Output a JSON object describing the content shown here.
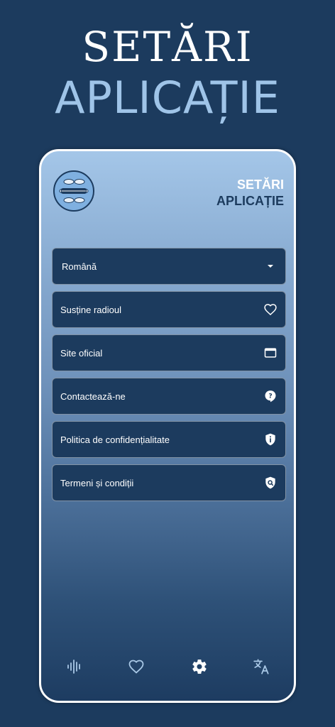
{
  "hero": {
    "line1": "SETĂRI",
    "line2": "APLICAȚIE"
  },
  "header": {
    "title_line1": "SETĂRI",
    "title_line2": "APLICAȚIE",
    "logo": "radio-fish-logo"
  },
  "menu": {
    "language": {
      "selected": "Română",
      "icon": "caret-down-icon"
    },
    "items": [
      {
        "label": "Susține radioul",
        "icon": "heart-outline-icon"
      },
      {
        "label": "Site oficial",
        "icon": "browser-window-icon"
      },
      {
        "label": "Contactează-ne",
        "icon": "help-bubble-icon"
      },
      {
        "label": "Politica de confidențialitate",
        "icon": "info-shield-icon"
      },
      {
        "label": "Termeni și condiții",
        "icon": "search-shield-icon"
      }
    ]
  },
  "bottom_nav": {
    "items": [
      {
        "name": "player",
        "icon": "audio-wave-icon"
      },
      {
        "name": "favorites",
        "icon": "heart-outline-icon"
      },
      {
        "name": "settings",
        "icon": "gear-icon",
        "active": true
      },
      {
        "name": "language",
        "icon": "translate-icon"
      }
    ]
  },
  "colors": {
    "background": "#1c3b5e",
    "hero_accent": "#9fc4e8",
    "row_bg": "#1c3b5e",
    "nav_inactive": "#a9c8e6",
    "nav_active": "#ffffff"
  }
}
